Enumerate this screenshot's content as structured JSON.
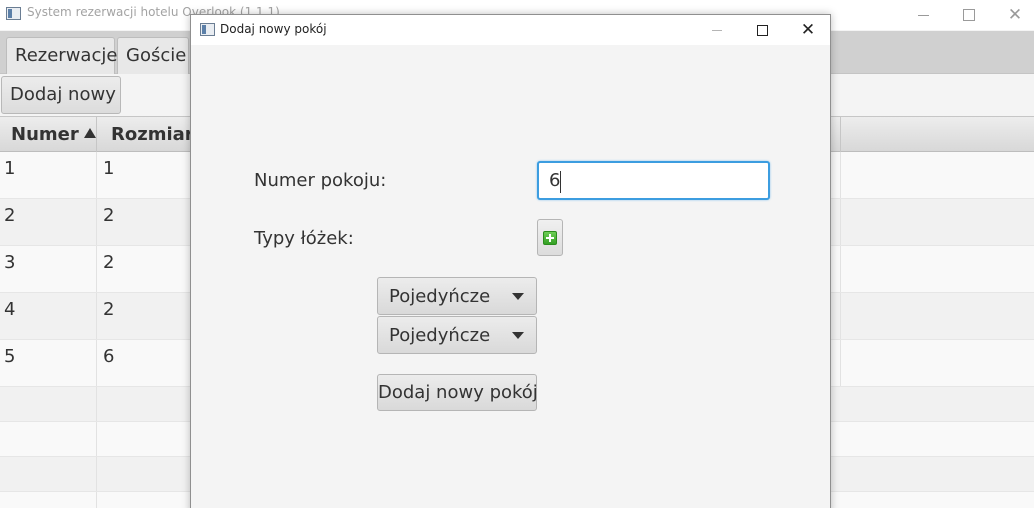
{
  "main_window": {
    "title": "System rezerwacji hotelu Overlook (1.1.1)",
    "tabs": [
      "Rezerwacje",
      "Goście"
    ],
    "add_new_label": "Dodaj nowy",
    "table": {
      "columns": [
        "Numer",
        "Rozmiar"
      ],
      "sorted_column": "Numer",
      "sort_direction": "ascending",
      "rows": [
        [
          "1",
          "1"
        ],
        [
          "2",
          "2"
        ],
        [
          "3",
          "2"
        ],
        [
          "4",
          "2"
        ],
        [
          "5",
          "6"
        ]
      ]
    }
  },
  "dialog": {
    "title": "Dodaj nowy pokój",
    "room_number_label": "Numer pokoju:",
    "room_number_value": "6",
    "bed_types_label": "Typy łóżek:",
    "add_bed_icon": "green-plus-icon",
    "bed_selects": [
      "Pojedyńcze",
      "Pojedyńcze"
    ],
    "submit_label": "Dodaj nowy pokój"
  },
  "colors": {
    "focus_border": "#3c9de0",
    "add_icon": "#34a024"
  }
}
